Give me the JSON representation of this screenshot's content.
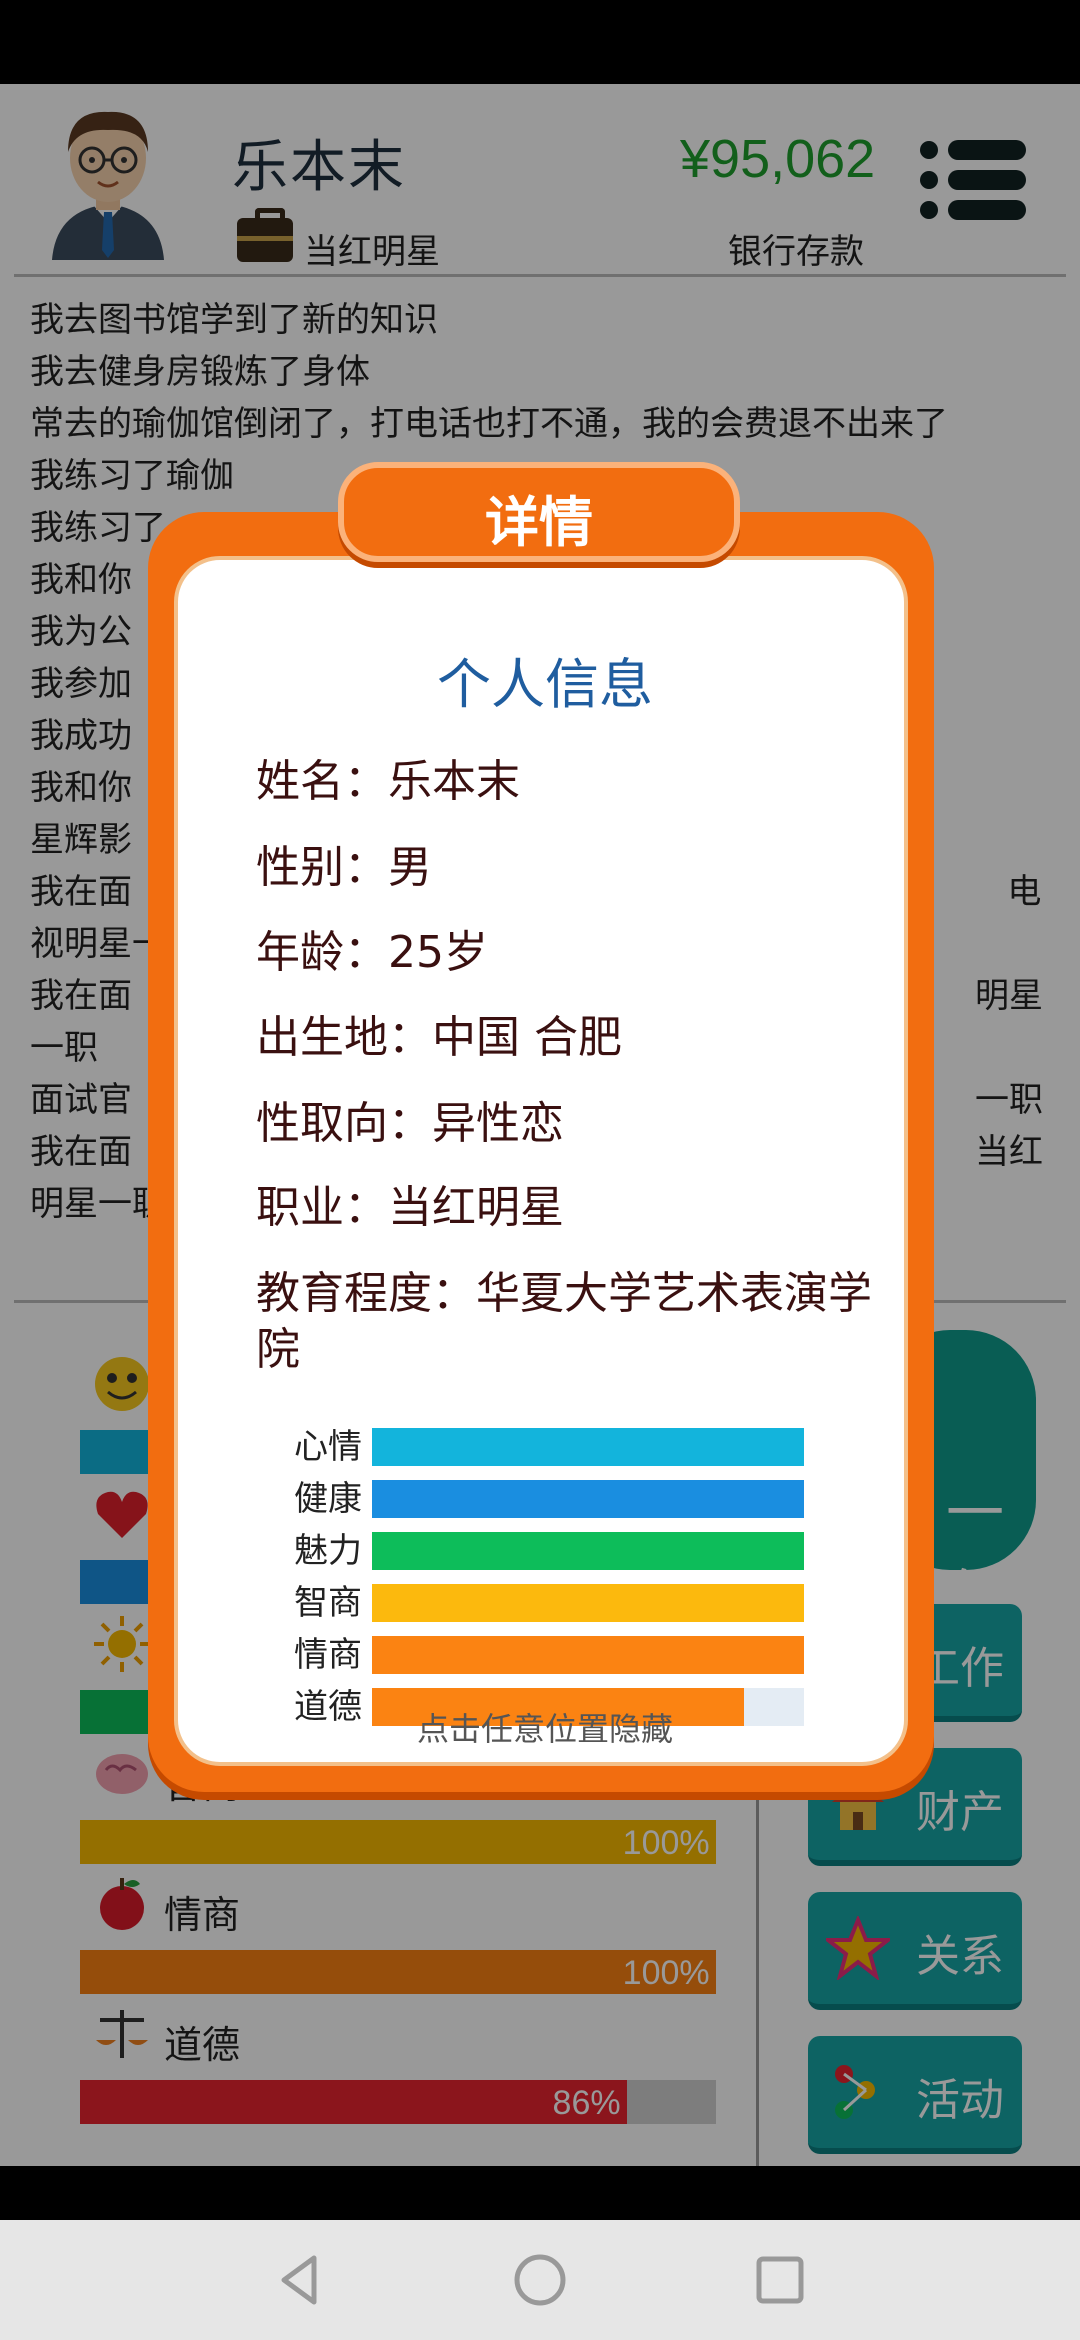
{
  "header": {
    "name": "乐本末",
    "job": "当红明星",
    "balance": "¥95,062",
    "balance_label": "银行存款"
  },
  "log": [
    "我去图书馆学到了新的知识",
    "我去健身房锻炼了身体",
    "常去的瑜伽馆倒闭了，打电话也打不通，我的会费退不出来了",
    "我练习了瑜伽",
    "我练习了",
    "我和你",
    "我为公",
    "我参加",
    "我成功",
    "我和你",
    "星辉影",
    "我在面                                                                                 电视明星一职",
    "我在面                                                                              明星一职",
    "面试官                                                                              一职",
    "我在面                                                                              当红明星一职"
  ],
  "stats": [
    {
      "label": "心情",
      "pct": "100%",
      "value": 100,
      "color": "#13b4dc"
    },
    {
      "label": "健康",
      "pct": "100%",
      "value": 100,
      "color": "#1a8ee0"
    },
    {
      "label": "魅力",
      "pct": "100%",
      "value": 100,
      "color": "#0dbd5a"
    },
    {
      "label": "智商",
      "pct": "100%",
      "value": 100,
      "color": "#f7b900"
    },
    {
      "label": "情商",
      "pct": "100%",
      "value": 100,
      "color": "#f98113"
    },
    {
      "label": "道德",
      "pct": "86%",
      "value": 86,
      "color": "#e8232f"
    }
  ],
  "side": {
    "next_year": "一年",
    "work": "工作",
    "property": "财产",
    "relations": "关系",
    "activities": "活动"
  },
  "dialog": {
    "tab": "详情",
    "title": "个人信息",
    "fields": [
      "姓名：乐本末",
      "性别：男",
      "年龄：25岁",
      "出生地：中国 合肥",
      "性取向：异性恋",
      "职业：当红明星",
      "教育程度：华夏大学艺术表演学院"
    ],
    "bars": [
      {
        "label": "心情",
        "value": 100,
        "color": "#13b4dc"
      },
      {
        "label": "健康",
        "value": 100,
        "color": "#1a8ee0"
      },
      {
        "label": "魅力",
        "value": 100,
        "color": "#0dbd5a"
      },
      {
        "label": "智商",
        "value": 100,
        "color": "#fcb90d"
      },
      {
        "label": "情商",
        "value": 100,
        "color": "#fb8312"
      },
      {
        "label": "道德",
        "value": 86,
        "color": "#fb8312"
      }
    ],
    "hint": "点击任意位置隐藏"
  },
  "icons": {
    "avatar": "avatar-icon",
    "job": "briefcase-icon",
    "menu": "menu-icon",
    "happy": "smiley-icon",
    "health": "heart-icon",
    "charm": "sun-icon",
    "iq": "brain-icon",
    "eq": "apple-icon",
    "morality": "scales-icon",
    "property": "house-icon",
    "relations": "star-icon",
    "activities": "dots-icon",
    "nav_back": "back-triangle-icon",
    "nav_home": "home-circle-icon",
    "nav_recent": "recent-square-icon"
  }
}
